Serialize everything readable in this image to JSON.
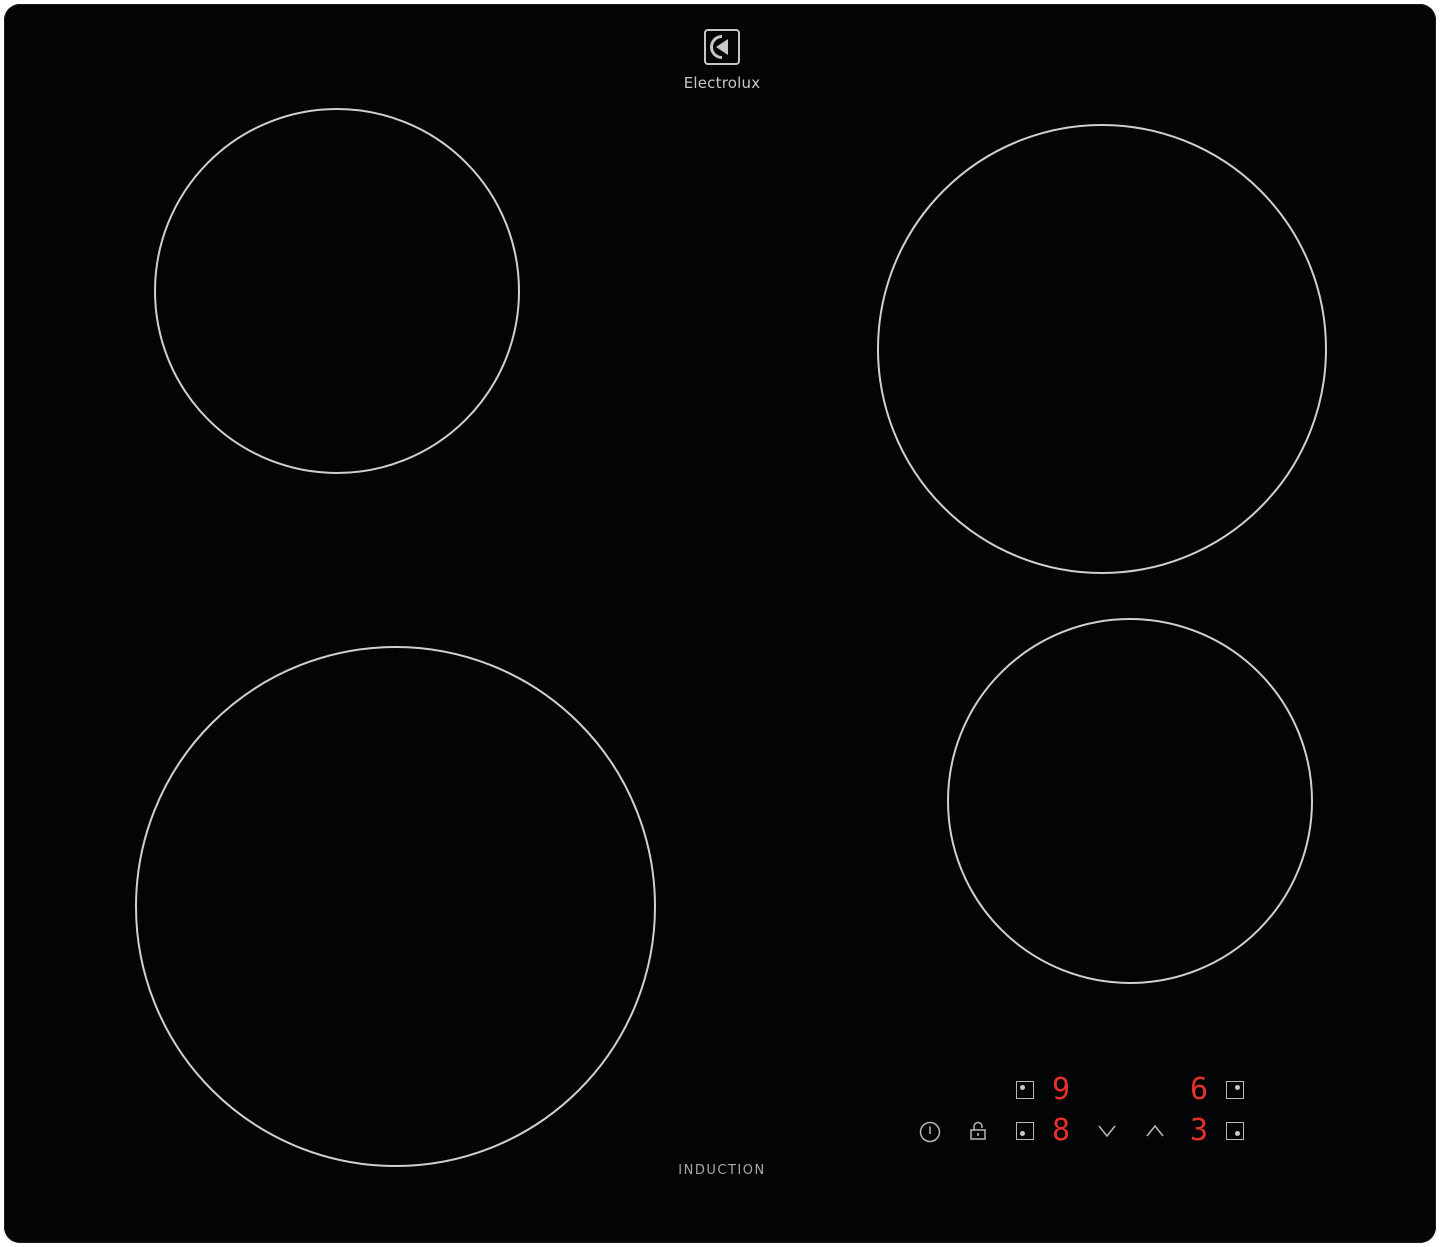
{
  "brand": {
    "name": "Electrolux",
    "logo_icon": "electrolux-logo-icon"
  },
  "colors": {
    "panel": "#030406",
    "zone_ring": "#cfd0d2",
    "display": "#e4322a",
    "control": "#b8b8b8"
  },
  "label": {
    "induction": "INDUCTION"
  },
  "controls": {
    "power_icon": "power-icon",
    "lock_icon": "lock-icon",
    "decrease_icon": "chevron-down-icon",
    "increase_icon": "chevron-up-icon"
  },
  "displays": {
    "back_left": "9",
    "front_left": "8",
    "back_right": "6",
    "front_right": "3"
  }
}
